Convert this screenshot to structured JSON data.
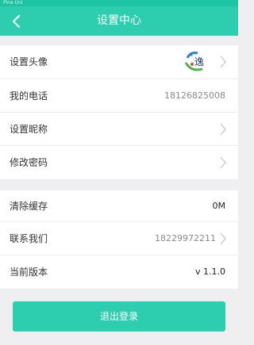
{
  "statusbar": {
    "text": "Pine Uni"
  },
  "header": {
    "title": "设置中心"
  },
  "settings": {
    "avatar_label": "设置头像",
    "phone_label": "我的电话",
    "phone_value": "18126825008",
    "nickname_label": "设置昵称",
    "password_label": "修改密码",
    "cache_label": "清除缓存",
    "cache_value": "0M",
    "contact_label": "联系我们",
    "contact_value": "18229972211",
    "version_label": "当前版本",
    "version_value": "v 1.1.0"
  },
  "footer": {
    "logout_label": "退出登录"
  },
  "colors": {
    "accent": "#2dcdb0",
    "background": "#efeff1",
    "chevron": "#c7c7c7"
  },
  "icons": {
    "back": "chevron-left-icon",
    "row_arrow": "chevron-right-icon",
    "avatar": "logo-avatar"
  }
}
